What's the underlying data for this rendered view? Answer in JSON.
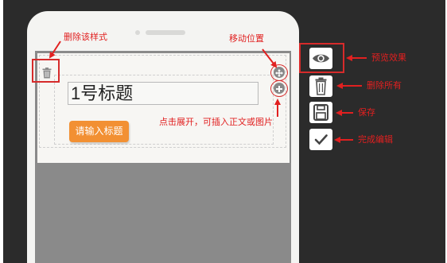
{
  "editor": {
    "title_text": "1号标题",
    "input_button_label": "请输入标题"
  },
  "annotations": {
    "delete_style": "删除该样式",
    "move_position": "移动位置",
    "expand_insert": "点击展开，可插入正文或图片",
    "preview_effect": "预览效果",
    "delete_all": "删除所有",
    "save": "保存",
    "finish_edit": "完成编辑"
  },
  "icons": {
    "delete_style": "trash-icon",
    "move": "move-icon",
    "expand": "plus-icon",
    "preview": "eye-icon",
    "delete_all": "trash-icon",
    "save": "save-icon",
    "finish": "check-icon"
  },
  "colors": {
    "accent": "#f29033",
    "annotation": "#e12020",
    "background": "#2b2b2b",
    "phone_body": "#f4f4f2",
    "screen": "#8a8a8a"
  }
}
